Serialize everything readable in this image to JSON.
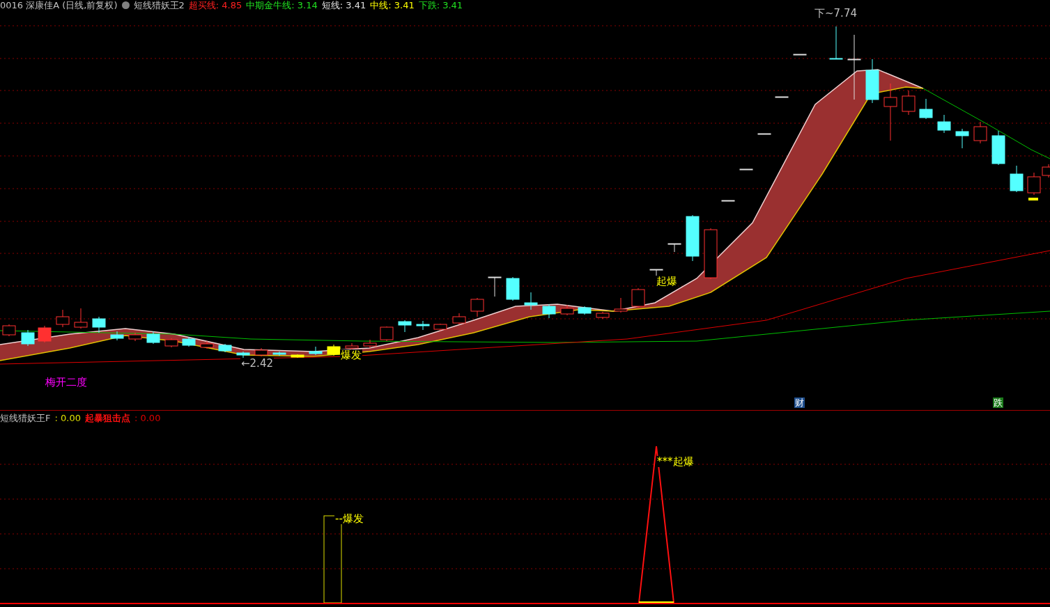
{
  "main_chart": {
    "legend": [
      {
        "text": "0016 深康佳A (日线,前复权)",
        "color": "#c0c0c0"
      },
      {
        "text": "短线猎妖王2",
        "color": "#c0c0c0"
      },
      {
        "text": "超买线: 4.85",
        "color": "#ff2020"
      },
      {
        "text": "中期金牛线: 3.14",
        "color": "#20e020"
      },
      {
        "text": "短线: 3.41",
        "color": "#e0e0e0"
      },
      {
        "text": "中线: 3.41",
        "color": "#ffff00"
      },
      {
        "text": "下跌: 3.41",
        "color": "#20e020"
      }
    ],
    "annotations": [
      {
        "text": "下~7.74",
        "kind": "label",
        "color": "#c0c0c0"
      },
      {
        "text": "←2.42",
        "kind": "label",
        "color": "#c0c0c0"
      },
      {
        "text": "起爆",
        "kind": "label",
        "color": "#ffff00"
      },
      {
        "text": "爆发",
        "kind": "label",
        "color": "#ffff00"
      },
      {
        "text": "梅开二度",
        "kind": "label",
        "color": "#ff00ff"
      },
      {
        "text": "财",
        "kind": "badge",
        "color": "#1f4f8f"
      },
      {
        "text": "跌",
        "kind": "badge",
        "color": "#1a7a1a"
      }
    ]
  },
  "indicator": {
    "legend": [
      {
        "text": "短线猎妖王F",
        "color": "#c0c0c0"
      },
      {
        "text": ": 0.00",
        "color": "#e0e000"
      },
      {
        "text": "起暴狙击点",
        "color": "#ff1010",
        "bold": true
      },
      {
        "text": ": 0.00",
        "color": "#e00000"
      }
    ],
    "annotations": [
      {
        "text": "***起爆",
        "color": "#ffff00"
      },
      {
        "text": "--爆发",
        "color": "#ffff00"
      }
    ]
  }
}
